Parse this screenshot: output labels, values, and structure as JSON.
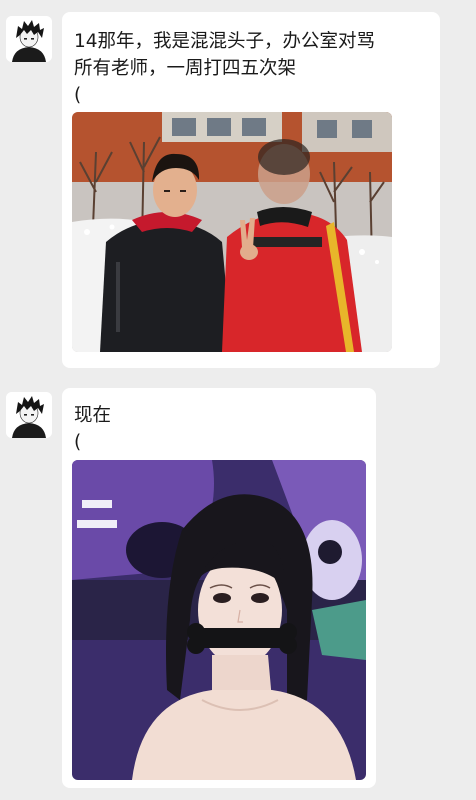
{
  "messages": [
    {
      "line1": "14那年，我是混混头子，办公室对骂",
      "line2": "所有老师，一周打四五次架",
      "line3": "(",
      "photo": "photo-two-boys-snow"
    },
    {
      "line1": "现在",
      "line2": "(",
      "photo": "photo-selfie-with-gag"
    }
  ]
}
